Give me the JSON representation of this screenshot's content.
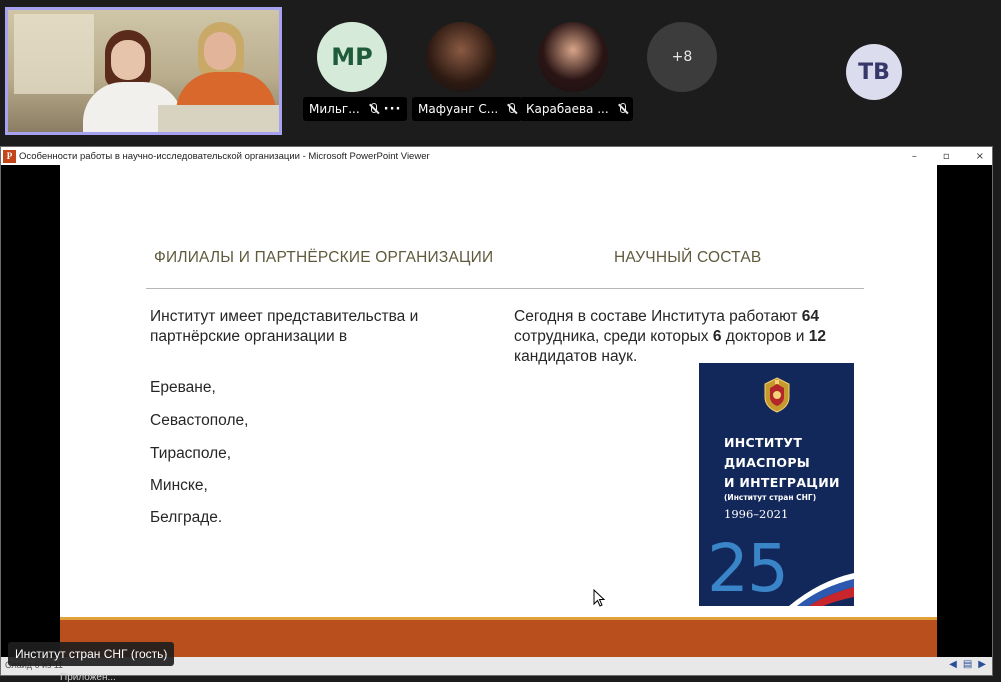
{
  "meeting": {
    "participants": [
      {
        "initials": "MP",
        "name": "Мильг..."
      },
      {
        "initials": "",
        "name": "Мафуанг С..."
      },
      {
        "initials": "",
        "name": "Карабаева ..."
      }
    ],
    "more_count": "+8",
    "self_initials": "TB"
  },
  "viewer": {
    "window_title": "Особенности работы в научно-исследовательской организации - Microsoft PowerPoint Viewer",
    "app_icon": "P",
    "minimize": "–",
    "restore": "▫",
    "close": "×",
    "status": "Слайд 6 из 11"
  },
  "slide": {
    "heading_left": "ФИЛИАЛЫ И ПАРТНЁРСКИЕ ОРГАНИЗАЦИИ",
    "heading_right": "НАУЧНЫЙ СОСТАВ",
    "left_intro": "Институт имеет представительства и партнёрские организации в",
    "cities": [
      "Ереване,",
      "Севастополе,",
      "Тирасполе,",
      "Минске,",
      "Белграде."
    ],
    "right_text": {
      "part1": "Сегодня в составе Института работают ",
      "employees": "64",
      "part2": " сотрудника, среди которых ",
      "doctors": "6",
      "part3": " докторов и ",
      "candidates": "12",
      "part4": " кандидатов наук."
    },
    "book": {
      "line1": "ИНСТИТУТ",
      "line2": "ДИАСПОРЫ",
      "line3": "И ИНТЕГРАЦИИ",
      "subtitle": "(Институт стран СНГ)",
      "years": "1996–2021",
      "number": "25"
    }
  },
  "name_tag": "Институт стран СНГ (гость)",
  "below_text": "Приложен...",
  "colors": {
    "accent_border": "#a7a2ef",
    "slide_bar": "#b94f1c",
    "book_blue": "#13285a"
  }
}
